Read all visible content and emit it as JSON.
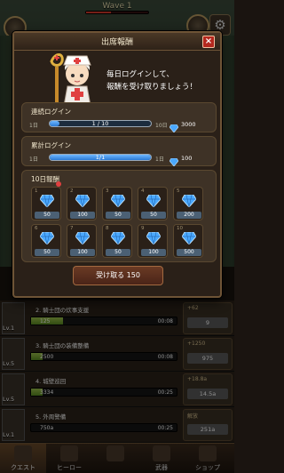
{
  "game": {
    "wave_label": "Wave 1"
  },
  "modal": {
    "title": "出席報酬",
    "close_label": "×",
    "message_line1": "毎日ログインして、",
    "message_line2": "報酬を受け取りましょう！",
    "consecutive": {
      "label": "連続ログイン",
      "start": "1日",
      "progress_text": "1 / 10",
      "progress": 0.1,
      "end": "10日",
      "reward": "3000"
    },
    "cumulative": {
      "label": "累計ログイン",
      "start": "1日",
      "progress_text": "1/1",
      "progress": 1.0,
      "end": "1日",
      "reward": "100"
    },
    "ten_day": {
      "label": "10日報酬",
      "days": [
        {
          "num": "1",
          "value": "50"
        },
        {
          "num": "2",
          "value": "100"
        },
        {
          "num": "3",
          "value": "50"
        },
        {
          "num": "4",
          "value": "50"
        },
        {
          "num": "5",
          "value": "200"
        },
        {
          "num": "6",
          "value": "50"
        },
        {
          "num": "7",
          "value": "100"
        },
        {
          "num": "8",
          "value": "50"
        },
        {
          "num": "9",
          "value": "100"
        },
        {
          "num": "10",
          "value": "500"
        }
      ]
    },
    "receive_label": "受け取る 150"
  },
  "quests": [
    {
      "name": "2. 騎士団の炊事支援",
      "level": "Lv.1",
      "amount": "125",
      "time": "00:08",
      "progress": 0.22,
      "inc": "+62",
      "cost": "9"
    },
    {
      "name": "3. 騎士団の装備整備",
      "level": "Lv.5",
      "amount": "2500",
      "time": "00:08",
      "progress": 0.08,
      "inc": "+1250",
      "cost": "975"
    },
    {
      "name": "4. 城壁巡回",
      "level": "Lv.5",
      "amount": "3334",
      "time": "00:25",
      "progress": 0.08,
      "inc": "+18.8a",
      "cost": "14.5a"
    },
    {
      "name": "5. 外周警備",
      "level": "Lv.1",
      "amount": "750a",
      "time": "00:25",
      "progress": 0.0,
      "inc": "解放",
      "cost": "251a"
    }
  ],
  "nav": [
    {
      "label": "クエスト"
    },
    {
      "label": "ヒーロー"
    },
    {
      "label": ""
    },
    {
      "label": "武器"
    },
    {
      "label": "ショップ"
    }
  ],
  "colors": {
    "accent_red": "#b4281e",
    "gem_blue": "#4aa8ff",
    "progress_blue": "#2a7ad6"
  }
}
